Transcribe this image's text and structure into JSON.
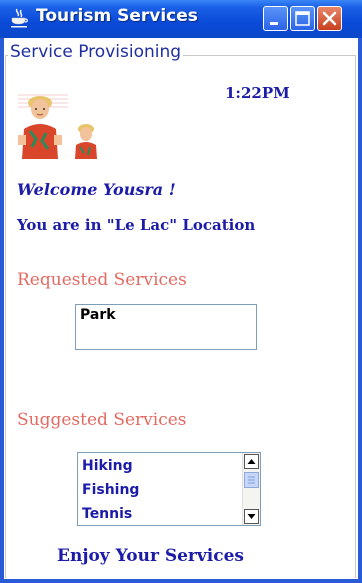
{
  "window": {
    "title": "Tourism Services",
    "icon": "java-cup-icon",
    "buttons": [
      "minimize-icon",
      "maximize-icon",
      "close-icon"
    ]
  },
  "panel": {
    "legend": "Service Provisioning",
    "time": "1:22PM",
    "avatar": "tourist-couple-image",
    "welcome": "Welcome Yousra !",
    "location_text": "You are in \"Le Lac\" Location"
  },
  "requested": {
    "title": "Requested Services",
    "items": [
      "Park"
    ]
  },
  "suggested": {
    "title": "Suggested Services",
    "items": [
      "Hiking",
      "Fishing",
      "Tennis"
    ]
  },
  "footer": {
    "text": "Enjoy Your Services"
  },
  "colors": {
    "titlebar": "#0a4ad8",
    "text_blue": "#1c1ca8",
    "section_red": "#e26a62"
  }
}
